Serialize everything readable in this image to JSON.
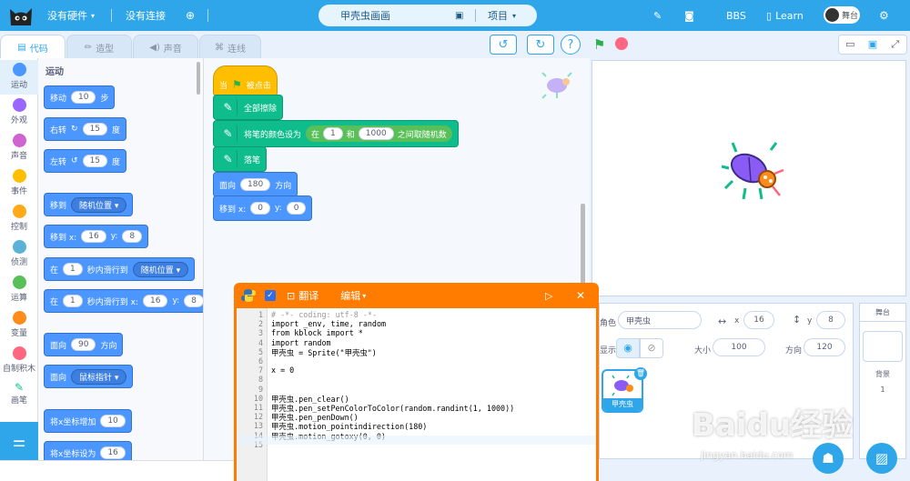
{
  "topbar": {
    "hardware": "没有硬件",
    "connection": "没有连接",
    "project_name": "甲壳虫画画",
    "project_menu": "项目",
    "bbs": "BBS",
    "learn": "Learn",
    "stage_toggle": "舞台"
  },
  "tabs": [
    {
      "label": "代码",
      "icon": "code-icon"
    },
    {
      "label": "造型",
      "icon": "brush-icon"
    },
    {
      "label": "声音",
      "icon": "speaker-icon"
    },
    {
      "label": "连线",
      "icon": "wire-icon"
    }
  ],
  "categories": [
    {
      "label": "运动",
      "color": "#4c97ff"
    },
    {
      "label": "外观",
      "color": "#9966ff"
    },
    {
      "label": "声音",
      "color": "#cf63cf"
    },
    {
      "label": "事件",
      "color": "#ffbf00"
    },
    {
      "label": "控制",
      "color": "#ffab19"
    },
    {
      "label": "侦测",
      "color": "#5cb1d6"
    },
    {
      "label": "运算",
      "color": "#59c059"
    },
    {
      "label": "变量",
      "color": "#ff8c1a"
    },
    {
      "label": "自制积木",
      "color": "#ff6680"
    },
    {
      "label": "画笔",
      "color": "#0fbd8c"
    }
  ],
  "palette": {
    "section": "运动",
    "move": {
      "a": "移动",
      "v": "10",
      "b": "步"
    },
    "turn_right": {
      "a": "右转",
      "v": "15",
      "b": "度"
    },
    "turn_left": {
      "a": "左转",
      "v": "15",
      "b": "度"
    },
    "goto": {
      "a": "移到",
      "v": "随机位置"
    },
    "goto_xy": {
      "a": "移到 x:",
      "x": "16",
      "yl": "y:",
      "y": "8"
    },
    "glide": {
      "a": "在",
      "v": "1",
      "b": "秒内滑行到",
      "d": "随机位置"
    },
    "glide_xy": {
      "a": "在",
      "v": "1",
      "b": "秒内滑行到 x:",
      "x": "16",
      "yl": "y:",
      "y": "8"
    },
    "point_dir": {
      "a": "面向",
      "v": "90",
      "b": "方向"
    },
    "point_to": {
      "a": "面向",
      "d": "鼠标指针"
    },
    "change_x": {
      "a": "将x坐标增加",
      "v": "10"
    },
    "set_x": {
      "a": "将x坐标设为",
      "v": "16"
    }
  },
  "script": {
    "hat": {
      "a": "当",
      "b": "被点击"
    },
    "clear": "全部擦除",
    "set_color": {
      "a": "将笔的颜色设为",
      "r1": "在",
      "v1": "1",
      "r2": "和",
      "v2": "1000",
      "r3": "之间取随机数"
    },
    "pen_down": "落笔",
    "point": {
      "a": "面向",
      "v": "180",
      "b": "方向"
    },
    "goto": {
      "a": "移到 x:",
      "x": "0",
      "yl": "y:",
      "y": "0"
    }
  },
  "python": {
    "translate": "翻译",
    "edit": "编辑",
    "lines": [
      "# -*- coding: utf-8 -*-",
      "import _env, time, random",
      "from kblock import *",
      "import random",
      "甲壳虫 = Sprite(\"甲壳虫\")",
      "",
      "x = 0",
      "",
      "",
      "甲壳虫.pen_clear()",
      "甲壳虫.pen_setPenColorToColor(random.randint(1, 1000))",
      "甲壳虫.pen_penDown()",
      "甲壳虫.motion_pointindirection(180)",
      "甲壳虫.motion_gotoxy(0, 0)",
      ""
    ]
  },
  "sprite_info": {
    "role_label": "角色",
    "role_name": "甲壳虫",
    "x_label": "x",
    "x": "16",
    "y_label": "y",
    "y": "8",
    "show_label": "显示",
    "size_label": "大小",
    "size": "100",
    "dir_label": "方向",
    "dir": "120",
    "thumb_label": "甲壳虫"
  },
  "stage_panel": {
    "title": "舞台",
    "backdrop_label": "背景",
    "backdrop_count": "1"
  },
  "watermark": {
    "main": "Baidu经验",
    "sub": "jingyan.baidu.com"
  }
}
